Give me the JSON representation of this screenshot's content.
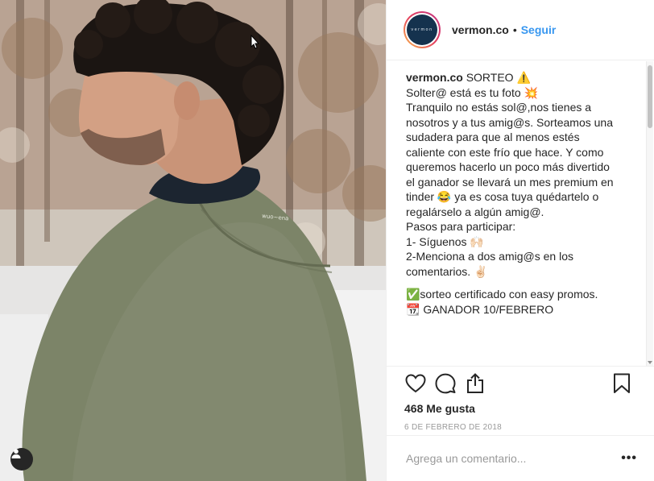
{
  "post": {
    "username": "vermon.co",
    "avatar_text": "vermon",
    "separator": "•",
    "follow_label": "Seguir",
    "caption_user": "vermon.co",
    "caption_lines": [
      "SORTEO ⚠️",
      "Solter@ está es tu foto 💥",
      "Tranquilo no estás sol@,nos tienes a",
      "nosotros y a tus amig@s. Sorteamos una",
      "sudadera para que al menos estés",
      "caliente con este frío que hace. Y como",
      "queremos hacerlo un poco más divertido",
      "el ganador se llevará un mes premium en",
      "tinder 😂 ya es cosa tuya quédartelo o",
      "regalárselo a algún amig@.",
      "Pasos para participar:",
      "1- Síguenos 🙌🏻",
      "2-Menciona a dos amig@s en los",
      "comentarios. ✌🏻"
    ],
    "caption_lines_2": [
      "✅sorteo certificado con easy promos.",
      "📆 GANADOR 10/FEBRERO"
    ],
    "likes": "468 Me gusta",
    "date": "6 DE FEBRERO DE 2018",
    "comment_placeholder": "Agrega un comentario...",
    "more_label": "•••"
  },
  "icons": {
    "like": "heart-icon",
    "comment": "comment-icon",
    "share": "share-icon",
    "save": "bookmark-icon",
    "tag": "user-tag-icon"
  },
  "colors": {
    "accent": "#3897f0",
    "text": "#262626",
    "muted": "#999999",
    "avatar_bg": "#15324e"
  }
}
